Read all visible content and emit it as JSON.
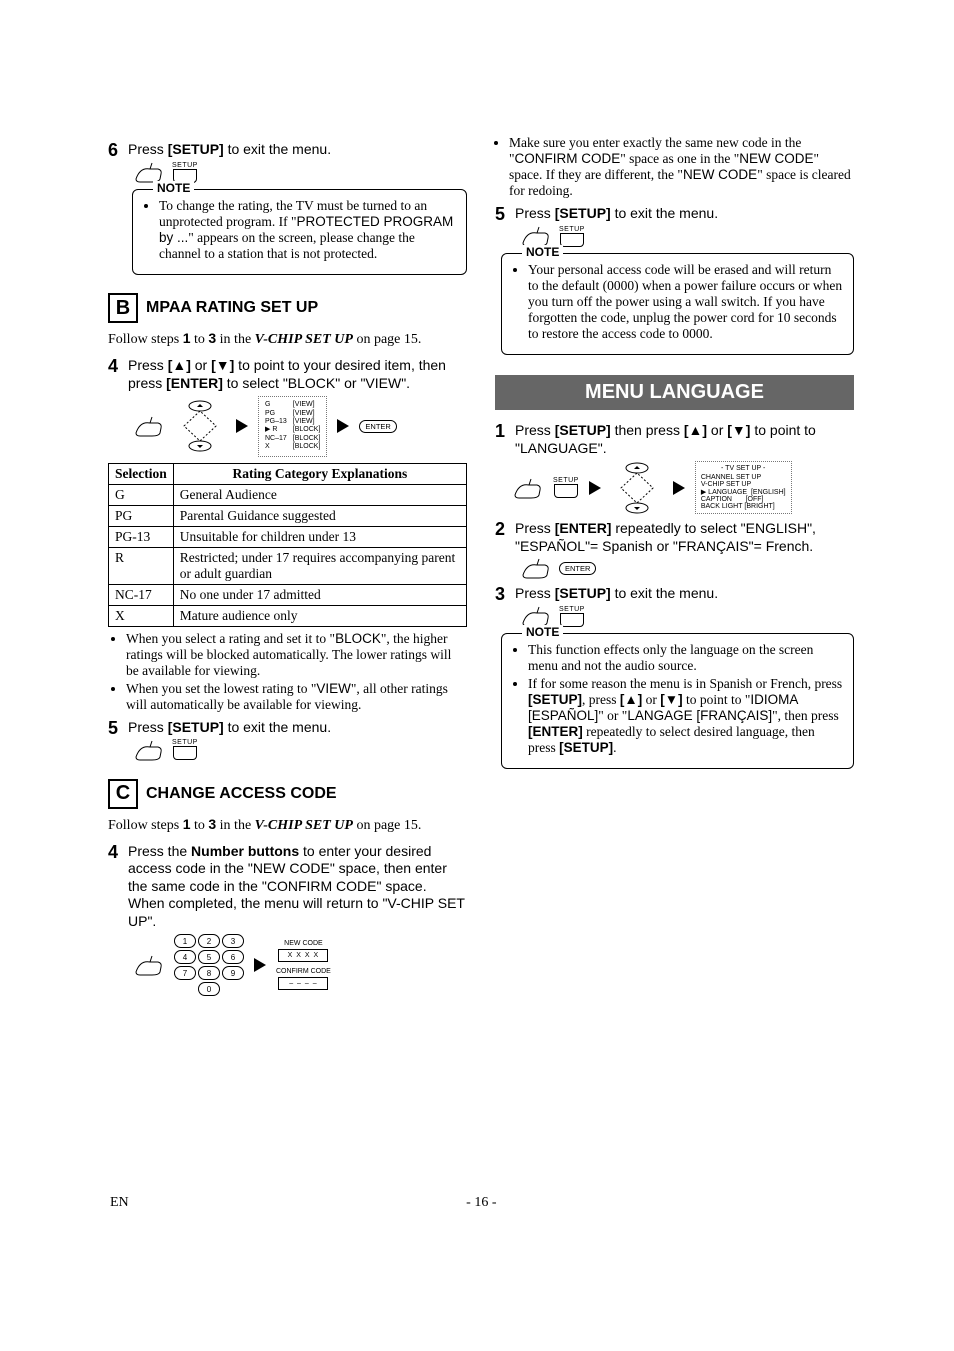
{
  "step6": {
    "num": "6",
    "text_prefix": "Press ",
    "btn": "[SETUP]",
    "text_suffix": " to exit the menu."
  },
  "setup_label": "SETUP",
  "enter_label": "ENTER",
  "note_label": "NOTE",
  "noteA": "To change the rating, the TV must be turned to an unprotected program. If \"PROTECTED PROGRAM by ...\" appears on the screen, please change the channel to a station that is not protected.",
  "secB": {
    "letter": "B",
    "title": "MPAA RATING SET UP"
  },
  "follow_text": {
    "pre": "Follow steps ",
    "a": "1",
    "mid": " to ",
    "b": "3",
    "post": " in the ",
    "ital": "V-CHIP SET UP",
    "end": " on page 15."
  },
  "step4B": {
    "num": "4",
    "pre": "Press ",
    "b1": "[K]",
    "mid": " or ",
    "b2": "[L]",
    "t2": " to point to your desired item, then press ",
    "b3": "[ENTER]",
    "t3": " to select \"BLOCK\" or \"VIEW\"."
  },
  "mpaa_osd": {
    "left": [
      "G",
      "PG",
      "PG–13",
      "R",
      "NC–17",
      "X"
    ],
    "right": [
      "[VIEW]",
      "[VIEW]",
      "[VIEW]",
      "[BLOCK]",
      "[BLOCK]",
      "[BLOCK]"
    ]
  },
  "rating_table": {
    "h1": "Selection",
    "h2": "Rating Category Explanations",
    "rows": [
      {
        "s": "G",
        "d": "General Audience"
      },
      {
        "s": "PG",
        "d": "Parental Guidance suggested"
      },
      {
        "s": "PG-13",
        "d": "Unsuitable for children under 13"
      },
      {
        "s": "R",
        "d": "Restricted; under 17 requires accompanying parent or adult guardian"
      },
      {
        "s": "NC-17",
        "d": "No one under 17 admitted"
      },
      {
        "s": "X",
        "d": "Mature audience only"
      }
    ]
  },
  "bulletsB": [
    "When you select a rating and set it to \"BLOCK\", the higher ratings will be blocked automatically. The lower ratings will be available for viewing.",
    "When you set the lowest rating to \"VIEW\", all other ratings will automatically be available for viewing."
  ],
  "step5B": {
    "num": "5",
    "pre": "Press ",
    "btn": "[SETUP]",
    "suf": " to exit the menu."
  },
  "secC": {
    "letter": "C",
    "title": "CHANGE ACCESS CODE"
  },
  "step4C": {
    "num": "4",
    "pre": "Press the ",
    "b": "Number buttons",
    "t": " to enter your desired access code in the \"NEW CODE\" space, then enter the same code in the \"CONFIRM CODE\" space. When completed, the menu will return to \"V-CHIP SET UP\"."
  },
  "code_pane": {
    "new": "NEW CODE",
    "newv": "X X X X",
    "conf": "CONFIRM CODE",
    "confv": "– – – –"
  },
  "keypad": [
    "1",
    "2",
    "3",
    "4",
    "5",
    "6",
    "7",
    "8",
    "9",
    "0"
  ],
  "right_intro": "Make sure you enter exactly the same new code in the \"CONFIRM CODE\" space as one in the \"NEW CODE\" space. If they are different, the \"NEW CODE\" space is cleared for redoing.",
  "step5R": {
    "num": "5",
    "pre": "Press ",
    "btn": "[SETUP]",
    "suf": " to exit the menu."
  },
  "noteR1": "Your personal access code will be erased and will return to the default (0000) when a power failure occurs or when you turn off the power using a wall switch. If you have forgotten the code, unplug the power cord for 10 seconds to restore the access code to 0000.",
  "menu_title": "MENU LANGUAGE",
  "step1M": {
    "num": "1",
    "pre": "Press ",
    "b1": "[SETUP]",
    "mid": " then press ",
    "b2": "[K]",
    "mid2": " or ",
    "b3": "[L]",
    "suf": " to point to \"LANGUAGE\"."
  },
  "tv_menu": {
    "hd": "- TV SET UP -",
    "l1": "CHANNEL SET UP",
    "l2": "V-CHIP SET UP",
    "l3a": "LANGUAGE",
    "l3b": "[ENGLISH]",
    "l4a": "CAPTION",
    "l4b": "[OFF]",
    "l5a": "BACK LIGHT",
    "l5b": "[BRIGHT]"
  },
  "step2M": {
    "num": "2",
    "pre": "Press ",
    "b": "[ENTER]",
    "suf": " repeatedly to select \"ENGLISH\", \"ESPAÑOL\"= Spanish or \"FRANÇAIS\"= French."
  },
  "step3M": {
    "num": "3",
    "pre": "Press ",
    "b": "[SETUP]",
    "suf": " to exit the menu."
  },
  "noteM": [
    "This function effects only the language on the screen menu and not the audio source.",
    {
      "pre": "If for some reason the menu is in Spanish or French, press ",
      "b1": "[SETUP]",
      "m1": ", press ",
      "b2": "[K]",
      "m2": " or ",
      "b3": "[L]",
      "m3": " to point to \"IDIOMA [ESPAÑOL]\" or \"LANGAGE [FRANÇAIS]\", then press ",
      "b4": "[ENTER]",
      "m4": " repeatedly to select desired language, then press ",
      "b5": "[SETUP]",
      "m5": "."
    }
  ],
  "footer": {
    "en": "EN",
    "page": "- 16 -"
  }
}
